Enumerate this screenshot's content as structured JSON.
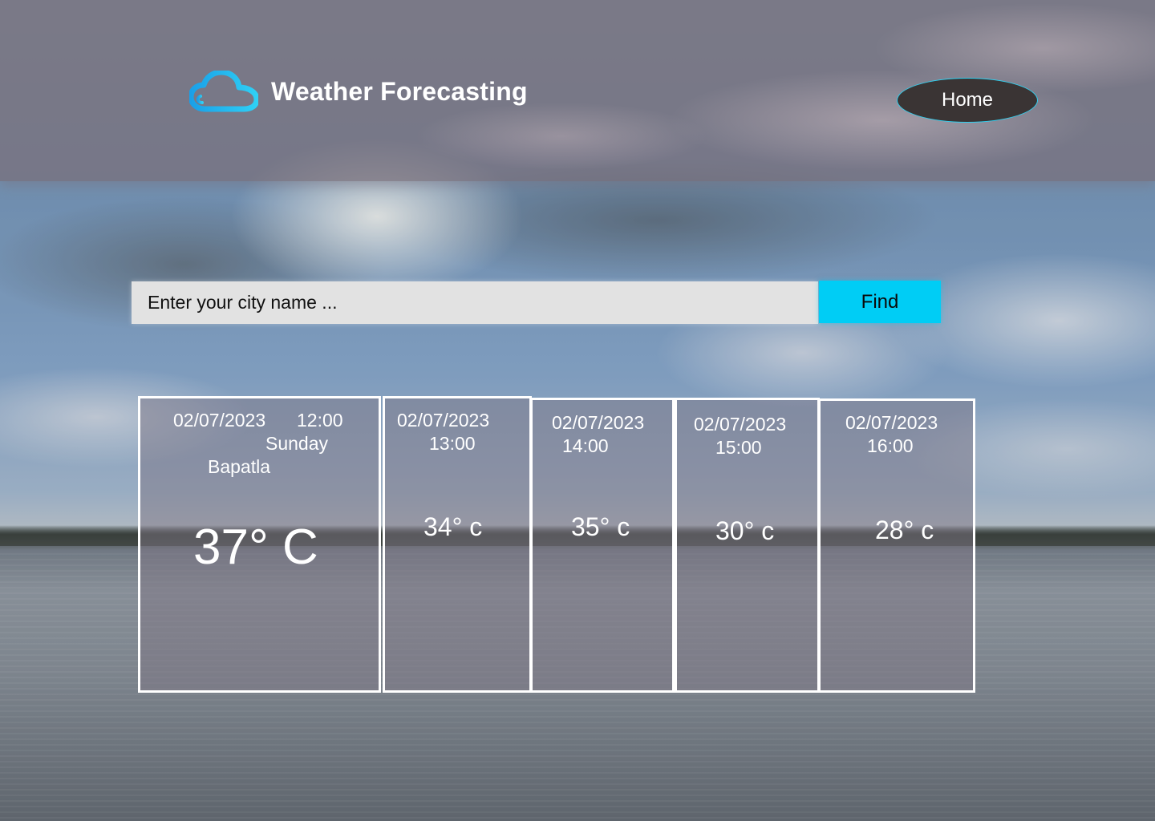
{
  "app": {
    "title": "Weather Forecasting",
    "logo_icon": "cloud-icon",
    "accent_color": "#00cdf5"
  },
  "nav": {
    "home_label": "Home"
  },
  "search": {
    "placeholder": "Enter your city name ...",
    "value": "",
    "button_label": "Find"
  },
  "current": {
    "date": "02/07/2023",
    "time": "12:00",
    "day": "Sunday",
    "city": "Bapatla",
    "temperature": "37° C"
  },
  "forecast": [
    {
      "date": "02/07/2023",
      "time": "13:00",
      "temperature": "34° c"
    },
    {
      "date": "02/07/2023",
      "time": "14:00",
      "temperature": "35° c"
    },
    {
      "date": "02/07/2023",
      "time": "15:00",
      "temperature": "30° c"
    },
    {
      "date": "02/07/2023",
      "time": "16:00",
      "temperature": "28° c"
    }
  ]
}
